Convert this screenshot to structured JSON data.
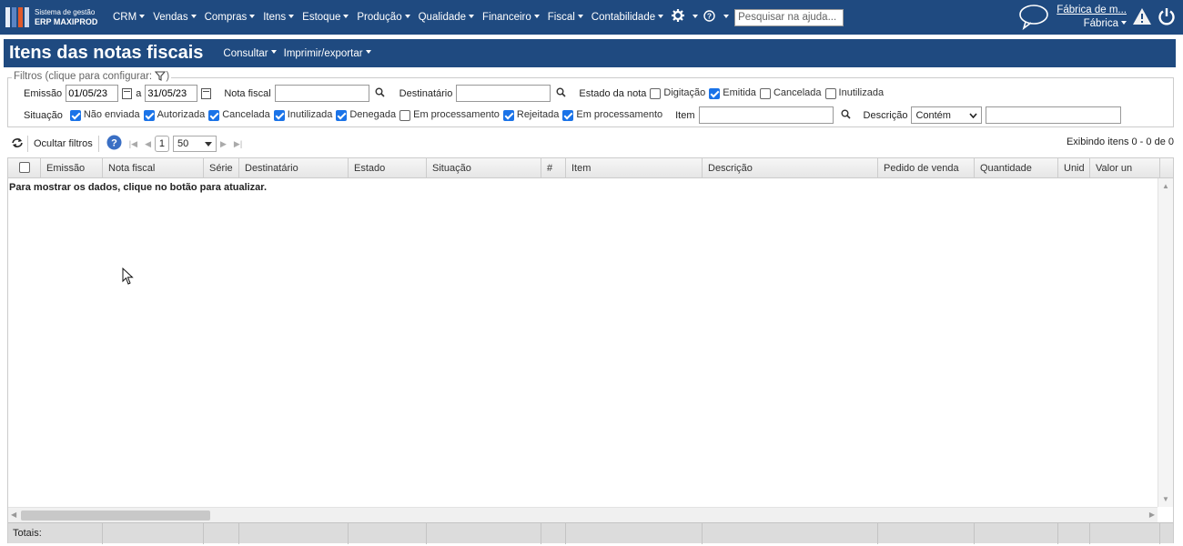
{
  "header": {
    "logo_line1": "Sistema de gestão",
    "logo_line2": "ERP MAXIPROD",
    "menu": [
      "CRM",
      "Vendas",
      "Compras",
      "Itens",
      "Estoque",
      "Produção",
      "Qualidade",
      "Financeiro",
      "Fiscal",
      "Contabilidade"
    ],
    "settings_icon": "gear-icon",
    "help_icon": "question-circle-icon",
    "help_search_placeholder": "Pesquisar na ajuda...",
    "company_link": "Fábrica de m...",
    "company_sub": "Fábrica"
  },
  "titlebar": {
    "title": "Itens das notas fiscais",
    "menus": [
      "Consultar",
      "Imprimir/exportar"
    ]
  },
  "filters": {
    "legend": "Filtros (clique para configurar:",
    "legend_end": ")",
    "emissao_label": "Emissão",
    "date_from": "01/05/23",
    "date_sep": "a",
    "date_to": "31/05/23",
    "nota_label": "Nota fiscal",
    "nota_value": "",
    "dest_label": "Destinatário",
    "dest_value": "",
    "estado_label": "Estado da nota",
    "estado_options": [
      {
        "label": "Digitação",
        "checked": false
      },
      {
        "label": "Emitida",
        "checked": true
      },
      {
        "label": "Cancelada",
        "checked": false
      },
      {
        "label": "Inutilizada",
        "checked": false
      }
    ],
    "situacao_label": "Situação",
    "situacao_options": [
      {
        "label": "Não enviada",
        "checked": true
      },
      {
        "label": "Autorizada",
        "checked": true
      },
      {
        "label": "Cancelada",
        "checked": true
      },
      {
        "label": "Inutilizada",
        "checked": true
      },
      {
        "label": "Denegada",
        "checked": true
      },
      {
        "label": "Em processamento",
        "checked": false
      },
      {
        "label": "Rejeitada",
        "checked": true
      },
      {
        "label": "Em processamento",
        "checked": true
      }
    ],
    "item_label": "Item",
    "item_value": "",
    "descricao_label": "Descrição",
    "descricao_mode": "Contém",
    "descricao_value": ""
  },
  "grid_toolbar": {
    "hide_filters": "Ocultar filtros",
    "page": "1",
    "page_size": "50",
    "status": "Exibindo itens 0 - 0 de 0"
  },
  "grid": {
    "columns": [
      "",
      "Emissão",
      "Nota fiscal",
      "Série",
      "Destinatário",
      "Estado",
      "Situação",
      "#",
      "Item",
      "Descrição",
      "Pedido de venda",
      "Quantidade",
      "Unid",
      "Valor un"
    ],
    "empty_message": "Para mostrar os dados, clique no botão para atualizar.",
    "totals_label": "Totais:"
  },
  "colors": {
    "brand": "#1f4a80",
    "checkbox": "#1a73e8"
  }
}
